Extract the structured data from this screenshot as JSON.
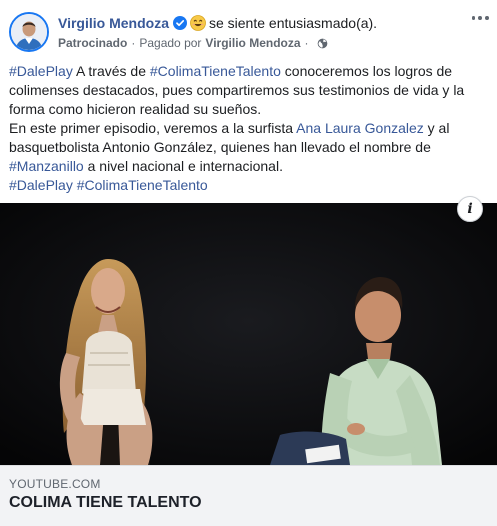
{
  "header": {
    "author_name": "Virgilio Mendoza",
    "feeling_text": "se siente entusiasmado(a).",
    "sponsored_label": "Patrocinado",
    "paid_by_prefix": "Pagado por",
    "paid_by_name": "Virgilio Mendoza",
    "separator_dot": "·",
    "icons": {
      "verified": "verified-badge-icon",
      "feeling": "smiling-emoji-icon",
      "privacy": "globe-icon",
      "more": "more-options-icon"
    }
  },
  "post": {
    "para1": {
      "t1": "#DalePlay",
      "t2": " A través de ",
      "t3": "#ColimaTieneTalento",
      "t4": " conoceremos los logros de colimenses destacados, pues compartiremos sus testimonios de vida y la forma como hicieron realidad su sueños."
    },
    "para2": {
      "t1": "En este primer episodio, veremos a la surfista ",
      "t2": "Ana Laura Gonzalez",
      "t3": " y al basquetbolista Antonio González, quienes han llevado el nombre de ",
      "t4": "#Manzanillo",
      "t5": " a nivel nacional e internacional."
    },
    "para3": {
      "t1": "#DalePlay",
      "t2": " ",
      "t3": "#ColimaTieneTalento"
    }
  },
  "media": {
    "info_label": "i"
  },
  "link_preview": {
    "domain": "YOUTUBE.COM",
    "title": "COLIMA TIENE TALENTO"
  },
  "colors": {
    "link": "#385898",
    "brand_blue": "#1877f2",
    "text": "#1c1e21",
    "meta": "#606770",
    "footer_bg": "#f2f3f5"
  }
}
